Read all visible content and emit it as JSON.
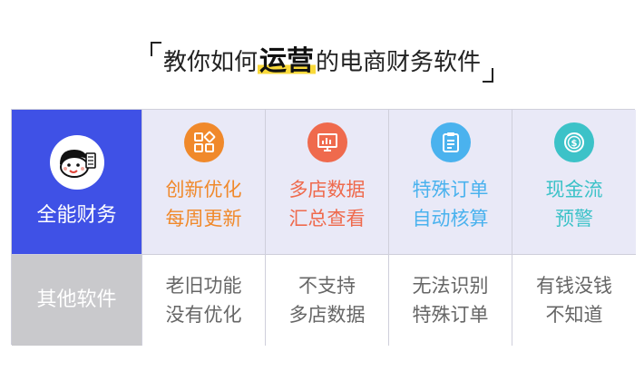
{
  "title": {
    "prefix": "教你如何",
    "highlight": "运营",
    "suffix": "的电商财务软件"
  },
  "row_ours": {
    "label": "全能财务",
    "features": [
      {
        "line1": "创新优化",
        "line2": "每周更新",
        "color": "#f0892b",
        "icon": "grid-squares-icon"
      },
      {
        "line1": "多店数据",
        "line2": "汇总查看",
        "color": "#ef6a4d",
        "icon": "bar-chart-monitor-icon"
      },
      {
        "line1": "特殊订单",
        "line2": "自动核算",
        "color": "#4ab2ee",
        "icon": "clipboard-list-icon"
      },
      {
        "line1": "现金流",
        "line2": "预警",
        "color": "#3cc2c8",
        "icon": "dollar-coin-icon"
      }
    ]
  },
  "row_others": {
    "label": "其他软件",
    "items": [
      {
        "line1": "老旧功能",
        "line2": "没有优化"
      },
      {
        "line1": "不支持",
        "line2": "多店数据"
      },
      {
        "line1": "无法识别",
        "line2": "特殊订单"
      },
      {
        "line1": "有钱没钱",
        "line2": "不知道"
      }
    ]
  }
}
